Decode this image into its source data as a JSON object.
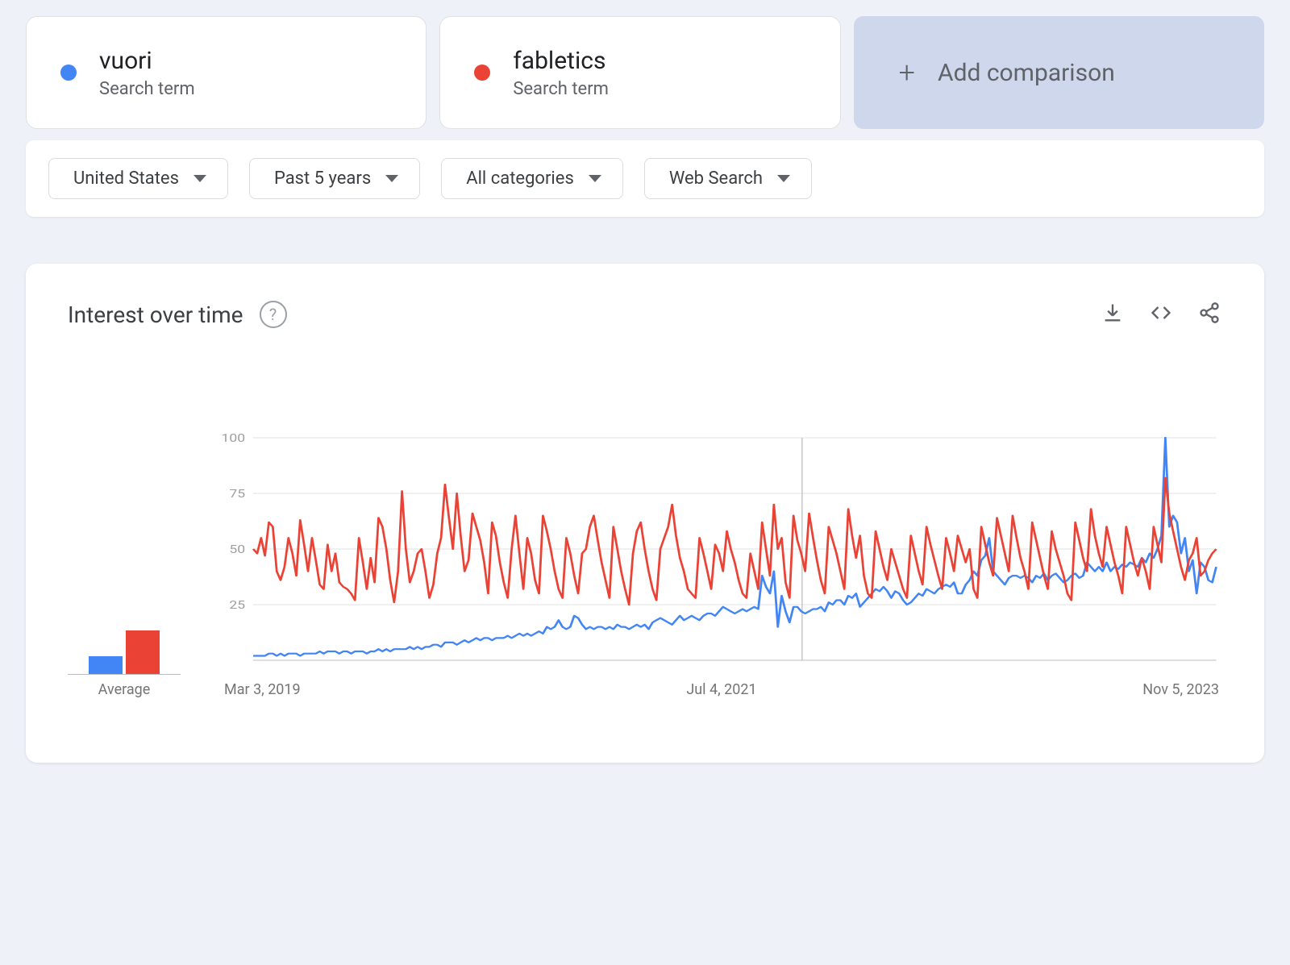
{
  "colors": {
    "series1": "#4285f4",
    "series2": "#ea4335"
  },
  "compare": {
    "terms": [
      {
        "name": "vuori",
        "type": "Search term",
        "color_key": "series1"
      },
      {
        "name": "fabletics",
        "type": "Search term",
        "color_key": "series2"
      }
    ],
    "add_label": "Add comparison"
  },
  "filters": {
    "geo": "United States",
    "time": "Past 5 years",
    "category": "All categories",
    "property": "Web Search"
  },
  "card": {
    "title": "Interest over time",
    "avg_label": "Average",
    "x_ticks": [
      "Mar 3, 2019",
      "Jul 4, 2021",
      "Nov 5, 2023"
    ]
  },
  "chart_data": {
    "type": "line",
    "ylim": [
      0,
      100
    ],
    "y_ticks": [
      25,
      50,
      75,
      100
    ],
    "xlabel": "",
    "ylabel": "",
    "x_start": "Mar 3, 2019",
    "x_end": "Nov 5, 2023",
    "averages": {
      "vuori": 18,
      "fabletics": 45
    },
    "series": [
      {
        "name": "vuori",
        "color_key": "series1",
        "values": [
          2,
          2,
          2,
          2,
          3,
          3,
          2,
          3,
          2,
          3,
          3,
          3,
          2,
          3,
          3,
          3,
          3,
          4,
          3,
          4,
          4,
          4,
          3,
          4,
          4,
          3,
          4,
          4,
          4,
          3,
          4,
          4,
          5,
          4,
          5,
          4,
          5,
          5,
          5,
          5,
          6,
          5,
          6,
          5,
          6,
          6,
          7,
          7,
          6,
          8,
          8,
          8,
          7,
          8,
          9,
          8,
          9,
          10,
          9,
          10,
          10,
          9,
          10,
          10,
          10,
          11,
          10,
          11,
          12,
          11,
          12,
          11,
          12,
          13,
          12,
          15,
          14,
          15,
          18,
          15,
          14,
          15,
          20,
          19,
          16,
          14,
          15,
          14,
          15,
          15,
          14,
          15,
          14,
          16,
          15,
          15,
          14,
          15,
          16,
          15,
          16,
          14,
          17,
          18,
          19,
          18,
          17,
          16,
          18,
          20,
          18,
          19,
          20,
          19,
          18,
          20,
          21,
          21,
          20,
          22,
          24,
          23,
          22,
          21,
          22,
          23,
          22,
          23,
          24,
          23,
          38,
          33,
          30,
          40,
          15,
          29,
          22,
          17,
          24,
          24,
          22,
          21,
          22,
          23,
          23,
          24,
          22,
          26,
          25,
          27,
          27,
          25,
          29,
          28,
          30,
          24,
          26,
          28,
          30,
          32,
          31,
          33,
          31,
          28,
          31,
          30,
          27,
          25,
          26,
          28,
          30,
          29,
          32,
          31,
          30,
          32,
          33,
          34,
          33,
          35,
          30,
          30,
          34,
          36,
          40,
          38,
          45,
          47,
          55,
          40,
          38,
          36,
          34,
          37,
          38,
          38,
          37,
          38,
          37,
          35,
          38,
          37,
          39,
          36,
          38,
          39,
          37,
          35,
          36,
          38,
          39,
          37,
          38,
          44,
          42,
          40,
          42,
          40,
          44,
          40,
          42,
          41,
          43,
          42,
          44,
          43,
          42,
          46,
          44,
          48,
          46,
          50,
          56,
          100,
          60,
          65,
          62,
          48,
          55,
          40,
          45,
          30,
          44,
          42,
          36,
          35,
          42
        ]
      },
      {
        "name": "fabletics",
        "color_key": "series2",
        "values": [
          50,
          48,
          55,
          47,
          62,
          60,
          40,
          36,
          42,
          55,
          48,
          38,
          63,
          52,
          40,
          55,
          45,
          34,
          32,
          52,
          40,
          48,
          35,
          33,
          32,
          30,
          27,
          55,
          44,
          32,
          46,
          35,
          64,
          60,
          50,
          36,
          26,
          40,
          76,
          50,
          35,
          40,
          48,
          50,
          40,
          28,
          34,
          48,
          55,
          79,
          64,
          50,
          75,
          56,
          40,
          45,
          66,
          60,
          54,
          44,
          30,
          62,
          56,
          44,
          35,
          28,
          50,
          65,
          48,
          32,
          55,
          48,
          36,
          30,
          65,
          58,
          50,
          40,
          32,
          28,
          55,
          48,
          38,
          30,
          48,
          50,
          60,
          65,
          54,
          44,
          36,
          28,
          60,
          50,
          40,
          32,
          25,
          48,
          58,
          62,
          50,
          40,
          32,
          27,
          50,
          55,
          60,
          70,
          56,
          46,
          40,
          32,
          30,
          28,
          55,
          48,
          40,
          32,
          52,
          48,
          40,
          58,
          50,
          44,
          36,
          30,
          28,
          48,
          40,
          32,
          62,
          50,
          38,
          70,
          50,
          55,
          35,
          28,
          65,
          54,
          48,
          40,
          66,
          55,
          45,
          36,
          30,
          60,
          54,
          48,
          40,
          32,
          68,
          56,
          46,
          56,
          38,
          30,
          28,
          58,
          50,
          42,
          36,
          50,
          44,
          38,
          32,
          28,
          56,
          48,
          40,
          34,
          60,
          52,
          45,
          38,
          32,
          55,
          48,
          40,
          56,
          50,
          44,
          50,
          32,
          28,
          60,
          52,
          44,
          38,
          64,
          56,
          48,
          40,
          65,
          55,
          46,
          40,
          32,
          62,
          54,
          46,
          38,
          32,
          58,
          50,
          44,
          38,
          30,
          27,
          62,
          54,
          46,
          40,
          68,
          56,
          48,
          42,
          60,
          52,
          44,
          38,
          30,
          60,
          52,
          44,
          38,
          46,
          40,
          32,
          60,
          52,
          44,
          82,
          66,
          58,
          50,
          42,
          36,
          45,
          48,
          55,
          38,
          40,
          45,
          48,
          50
        ]
      }
    ]
  }
}
